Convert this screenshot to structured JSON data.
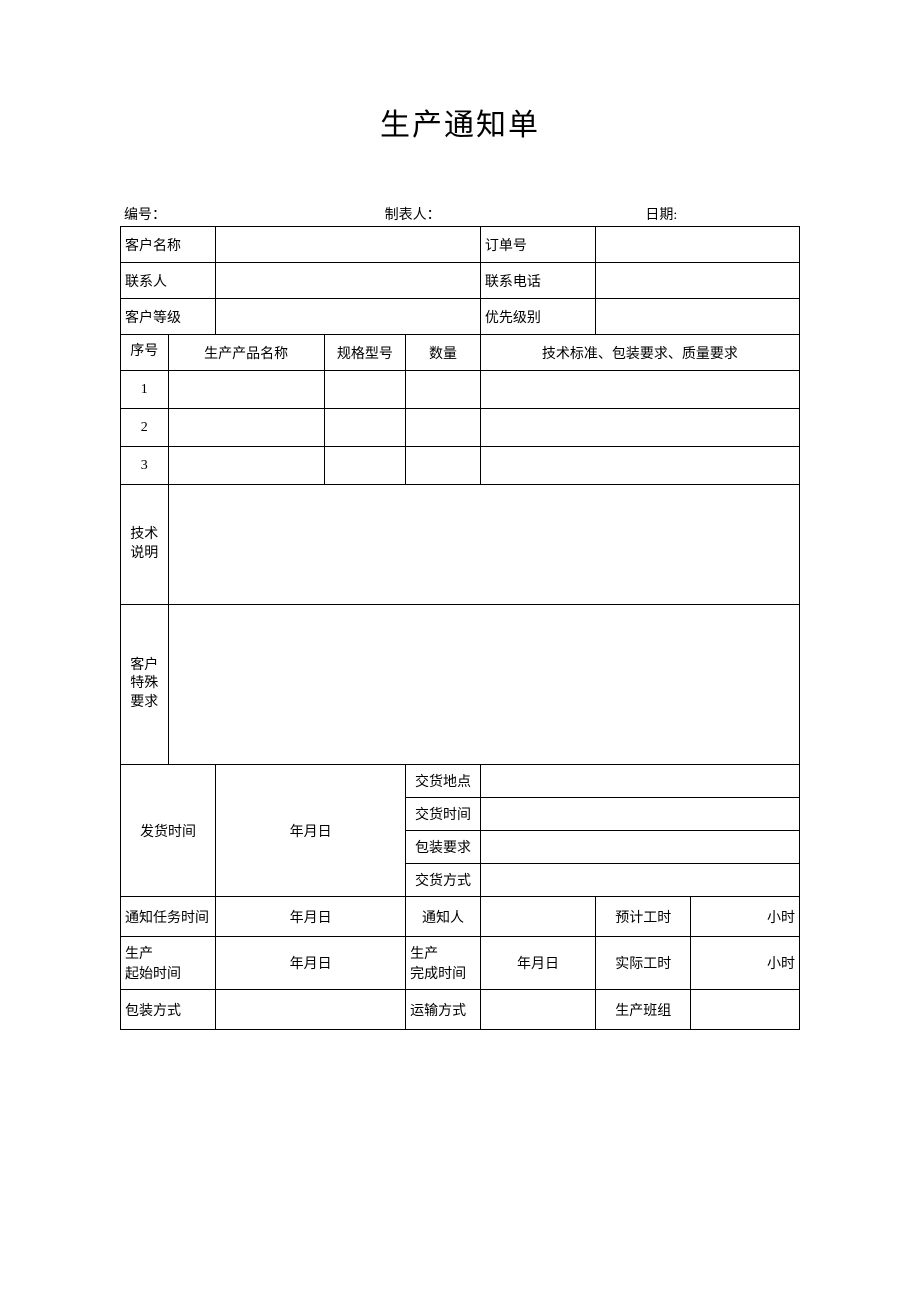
{
  "title": "生产通知单",
  "meta": {
    "serial_label": "编号：",
    "preparer_label": "制表人：",
    "date_label": "日期:"
  },
  "header": {
    "customer_name_label": "客户名称",
    "customer_name_value": "",
    "order_no_label": "订单号",
    "order_no_value": "",
    "contact_label": "联系人",
    "contact_value": "",
    "phone_label": "联系电话",
    "phone_value": "",
    "customer_level_label": "客户等级",
    "customer_level_value": "",
    "priority_label": "优先级别",
    "priority_value": ""
  },
  "items_header": {
    "seq": "序号",
    "name": "生产产品名称",
    "spec": "规格型号",
    "qty": "数量",
    "req": "技术标准、包装要求、质量要求"
  },
  "items": [
    {
      "seq": "1",
      "name": "",
      "spec": "",
      "qty": "",
      "req": ""
    },
    {
      "seq": "2",
      "name": "",
      "spec": "",
      "qty": "",
      "req": ""
    },
    {
      "seq": "3",
      "name": "",
      "spec": "",
      "qty": "",
      "req": ""
    }
  ],
  "tech_desc_label": "技术说明",
  "tech_desc_value": "",
  "cust_req_label": "客户特殊要求",
  "cust_req_value": "",
  "shipping": {
    "ship_time_label": "发货时间",
    "ship_time_value": "年月日",
    "delivery_place_label": "交货地点",
    "delivery_place_value": "",
    "delivery_time_label": "交货时间",
    "delivery_time_value": "",
    "packing_req_label": "包装要求",
    "packing_req_value": "",
    "delivery_method_label": "交货方式",
    "delivery_method_value": ""
  },
  "notice": {
    "notice_time_label": "通知任务时间",
    "notice_time_value": "年月日",
    "notifier_label": "通知人",
    "notifier_value": "",
    "est_hours_label": "预计工时",
    "est_hours_value": "小时"
  },
  "prod": {
    "start_label_l1": "生产",
    "start_label_l2": "起始时间",
    "start_value": "年月日",
    "finish_label_l1": "生产",
    "finish_label_l2": "完成时间",
    "finish_value": "年月日",
    "actual_hours_label": "实际工时",
    "actual_hours_value": "小时"
  },
  "footer": {
    "pack_method_label": "包装方式",
    "pack_method_value": "",
    "transport_label": "运输方式",
    "transport_value": "",
    "team_label": "生产班组",
    "team_value": ""
  }
}
